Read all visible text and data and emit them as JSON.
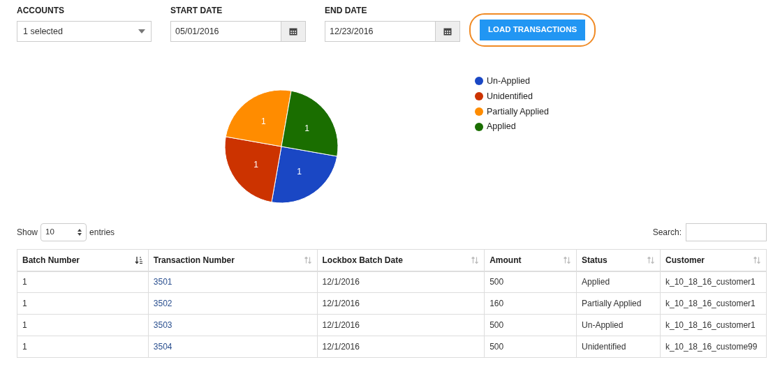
{
  "filters": {
    "accounts": {
      "label": "ACCOUNTS",
      "value": "1 selected"
    },
    "start_date": {
      "label": "START DATE",
      "value": "05/01/2016"
    },
    "end_date": {
      "label": "END DATE",
      "value": "12/23/2016"
    },
    "load_button": {
      "label": "LOAD TRANSACTIONS",
      "highlighted": true
    }
  },
  "chart_data": {
    "type": "pie",
    "data_labels": true,
    "categories": [
      "Un-Applied",
      "Unidentified",
      "Partially Applied",
      "Applied"
    ],
    "values": [
      1,
      1,
      1,
      1
    ],
    "colors": [
      "#1a47c4",
      "#cc3300",
      "#ff8c00",
      "#1a6e00"
    ]
  },
  "table_controls": {
    "show_label": "Show",
    "page_size": "10",
    "entries_label": "entries",
    "search_label": "Search:"
  },
  "table": {
    "columns": [
      {
        "label": "Batch Number",
        "sorted": true
      },
      {
        "label": "Transaction Number",
        "sorted": false
      },
      {
        "label": "Lockbox Batch Date",
        "sorted": false
      },
      {
        "label": "Amount",
        "sorted": false
      },
      {
        "label": "Status",
        "sorted": false
      },
      {
        "label": "Customer",
        "sorted": false
      }
    ],
    "rows": [
      [
        "1",
        "3501",
        "12/1/2016",
        "500",
        "Applied",
        "k_10_18_16_customer1"
      ],
      [
        "1",
        "3502",
        "12/1/2016",
        "160",
        "Partially Applied",
        "k_10_18_16_customer1"
      ],
      [
        "1",
        "3503",
        "12/1/2016",
        "500",
        "Un-Applied",
        "k_10_18_16_customer1"
      ],
      [
        "1",
        "3504",
        "12/1/2016",
        "500",
        "Unidentified",
        "k_10_18_16_custome99"
      ]
    ]
  }
}
